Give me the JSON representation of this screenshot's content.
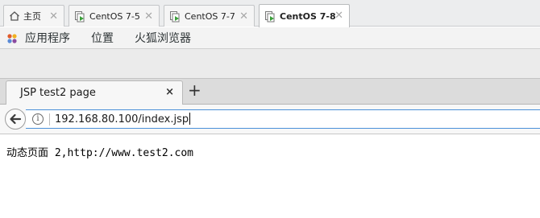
{
  "vm_tabs": [
    {
      "label": "主页",
      "icon": "home-icon",
      "active": false
    },
    {
      "label": "CentOS 7-5",
      "icon": "vm-icon",
      "active": false
    },
    {
      "label": "CentOS 7-7",
      "icon": "vm-icon",
      "active": false
    },
    {
      "label": "CentOS 7-8",
      "icon": "vm-icon",
      "active": true
    }
  ],
  "gnome_panel": {
    "applications": "应用程序",
    "places": "位置",
    "firefox": "火狐浏览器"
  },
  "browser": {
    "tab_title": "JSP test2 page",
    "tab_close": "×",
    "new_tab": "+",
    "url": "192.168.80.100/index.jsp"
  },
  "page": {
    "content": "动态页面 2,http://www.test2.com"
  }
}
